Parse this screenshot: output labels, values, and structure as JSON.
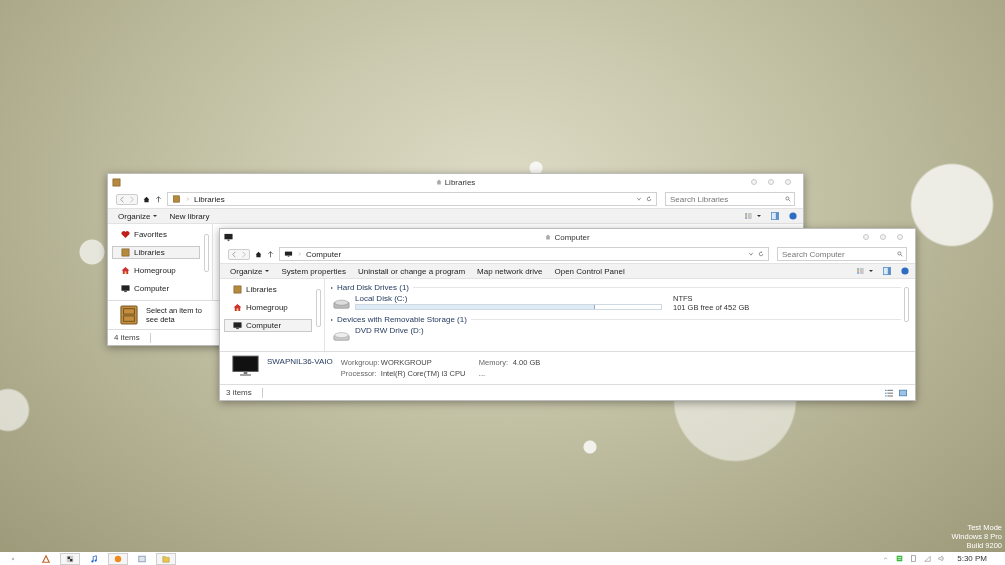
{
  "desktop": {
    "watermark": [
      "Test Mode",
      "Windows 8 Pro",
      "Build 9200"
    ]
  },
  "windows": [
    {
      "kind": "libraries",
      "title": "Libraries",
      "address": "Libraries",
      "search_placeholder": "Search Libraries",
      "toolbar": [
        {
          "label": "Organize",
          "dropdown": true
        },
        {
          "label": "New library",
          "dropdown": false
        }
      ],
      "sidebar": [
        {
          "label": "Favorites",
          "kind": "favorites",
          "selected": false
        },
        {
          "label": "Libraries",
          "kind": "libraries",
          "selected": true
        },
        {
          "label": "Homegroup",
          "kind": "homegroup",
          "selected": false
        },
        {
          "label": "Computer",
          "kind": "computer",
          "selected": false
        }
      ],
      "details": {
        "kind": "library",
        "text": "Select an item to see deta"
      },
      "status": "4 items"
    },
    {
      "kind": "computer",
      "title": "Computer",
      "address": "Computer",
      "search_placeholder": "Search Computer",
      "toolbar": [
        {
          "label": "Organize",
          "dropdown": true
        },
        {
          "label": "System properties",
          "dropdown": false
        },
        {
          "label": "Uninstall or change a program",
          "dropdown": false
        },
        {
          "label": "Map network drive",
          "dropdown": false
        },
        {
          "label": "Open Control Panel",
          "dropdown": false
        }
      ],
      "sidebar": [
        {
          "label": "Libraries",
          "kind": "libraries",
          "selected": false
        },
        {
          "label": "Homegroup",
          "kind": "homegroup",
          "selected": false
        },
        {
          "label": "Computer",
          "kind": "computer",
          "selected": true
        }
      ],
      "groups": [
        {
          "title": "Hard Disk Drives (1)",
          "drives": [
            {
              "name": "Local Disk (C:)",
              "kind": "hard_disk",
              "level": 0.78,
              "filesystem": "NTFS",
              "space": "101 GB free of 452 GB"
            }
          ]
        },
        {
          "title": "Devices with Removable Storage (1)",
          "drives": [
            {
              "name": "DVD RW Drive (D:)",
              "kind": "optical"
            }
          ]
        }
      ],
      "details": {
        "kind": "computer",
        "name": "SWAPNIL36-VAIO",
        "fields": [
          {
            "label": "Workgroup:",
            "value": "WORKGROUP"
          },
          {
            "label": "Memory:",
            "value": "4.00 GB"
          },
          {
            "label": "Processor:",
            "value": "Intel(R) Core(TM) i3 CPU"
          }
        ],
        "more": "..."
      },
      "status": "3 items"
    }
  ],
  "taskbar": {
    "apps": [
      {
        "kind": "pen",
        "running": false
      },
      {
        "kind": "grid",
        "running": true
      },
      {
        "kind": "music",
        "running": false
      },
      {
        "kind": "ball",
        "running": true
      },
      {
        "kind": "window",
        "running": false
      },
      {
        "kind": "folder",
        "running": true
      }
    ],
    "clock": "5:30 PM"
  }
}
